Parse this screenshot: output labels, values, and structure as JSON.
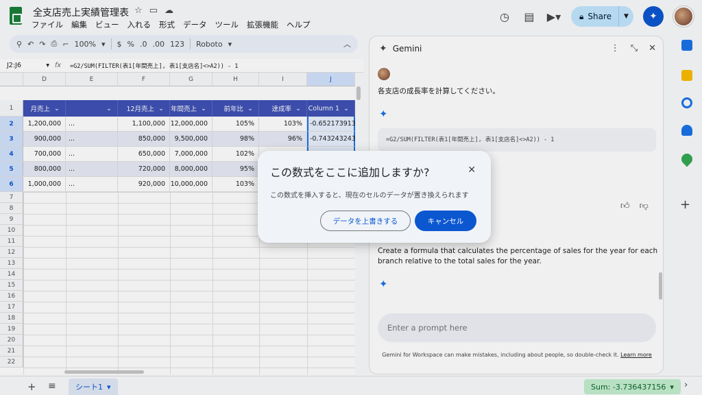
{
  "app": {
    "doc_title": "全支店売上実績管理表",
    "menu": [
      "ファイル",
      "編集",
      "ビュー",
      "入れる",
      "形式",
      "データ",
      "ツール",
      "拡張機能",
      "ヘルプ"
    ],
    "share_label": "Share"
  },
  "toolbar": {
    "zoom": "100%",
    "currency": "$",
    "percent": "%",
    "dec_less": ".0",
    "dec_more": ".00",
    "number_fmt": "123",
    "font": "Roboto"
  },
  "formula_bar": {
    "cell_ref": "J2:J6",
    "fx": "fx",
    "formula": "=G2/SUM(FILTER(表1[年間売上], 表1[支店名]<>A2)) - 1"
  },
  "sheet": {
    "col_letters": [
      "D",
      "E",
      "F",
      "G",
      "H",
      "I",
      "J"
    ],
    "row_numbers": [
      "1",
      "2",
      "3",
      "4",
      "5",
      "6",
      "7",
      "8",
      "9",
      "10",
      "11",
      "12",
      "13",
      "14",
      "15",
      "16",
      "17",
      "18",
      "19",
      "20",
      "21",
      "22"
    ],
    "headers": [
      "月売上",
      "",
      "12月売上",
      "年間売上",
      "前年比",
      "達成率",
      "Column 1"
    ],
    "rows": [
      [
        "1,200,000",
        "...",
        "1,100,000",
        "12,000,000",
        "105%",
        "103%",
        "-0.652173913"
      ],
      [
        "900,000",
        "...",
        "850,000",
        "9,500,000",
        "98%",
        "96%",
        "-0.743243243"
      ],
      [
        "700,000",
        "...",
        "650,000",
        "7,000,000",
        "102%",
        "",
        ""
      ],
      [
        "800,000",
        "...",
        "720,000",
        "8,000,000",
        "95%",
        "",
        ""
      ],
      [
        "1,000,000",
        "...",
        "920,000",
        "10,000,000",
        "103%",
        "",
        ""
      ]
    ],
    "tab_name": "シート1",
    "sum_label": "Sum: -3.736437156"
  },
  "gemini": {
    "title": "Gemini",
    "user_message": "各支店の成長率を計算してください。",
    "formula": "=G2/SUM(FILTER(表1[年間売上], 表1[支店名]<>A2)) - 1",
    "response_text": "Create a formula that calculates the percentage of sales for the year for each branch relative to the total sales for the year.",
    "input_placeholder": "Enter a prompt here",
    "disclaimer": "Gemini for Workspace can make mistakes, including about people, so double-check it.",
    "learn_more": "Learn more"
  },
  "dialog": {
    "title": "この数式をここに追加しますか?",
    "body": "この数式を挿入すると、現在のセルのデータが置き換えられます",
    "overwrite_label": "データを上書きする",
    "cancel_label": "キャンセル",
    "close_icon": "close-icon"
  },
  "colors": {
    "table_header": "#3f51b5",
    "band": "#e8eaf6",
    "primary_button": "#0b57d0",
    "share_bg": "#c2e7ff",
    "sum_bg": "#c4eed0"
  }
}
